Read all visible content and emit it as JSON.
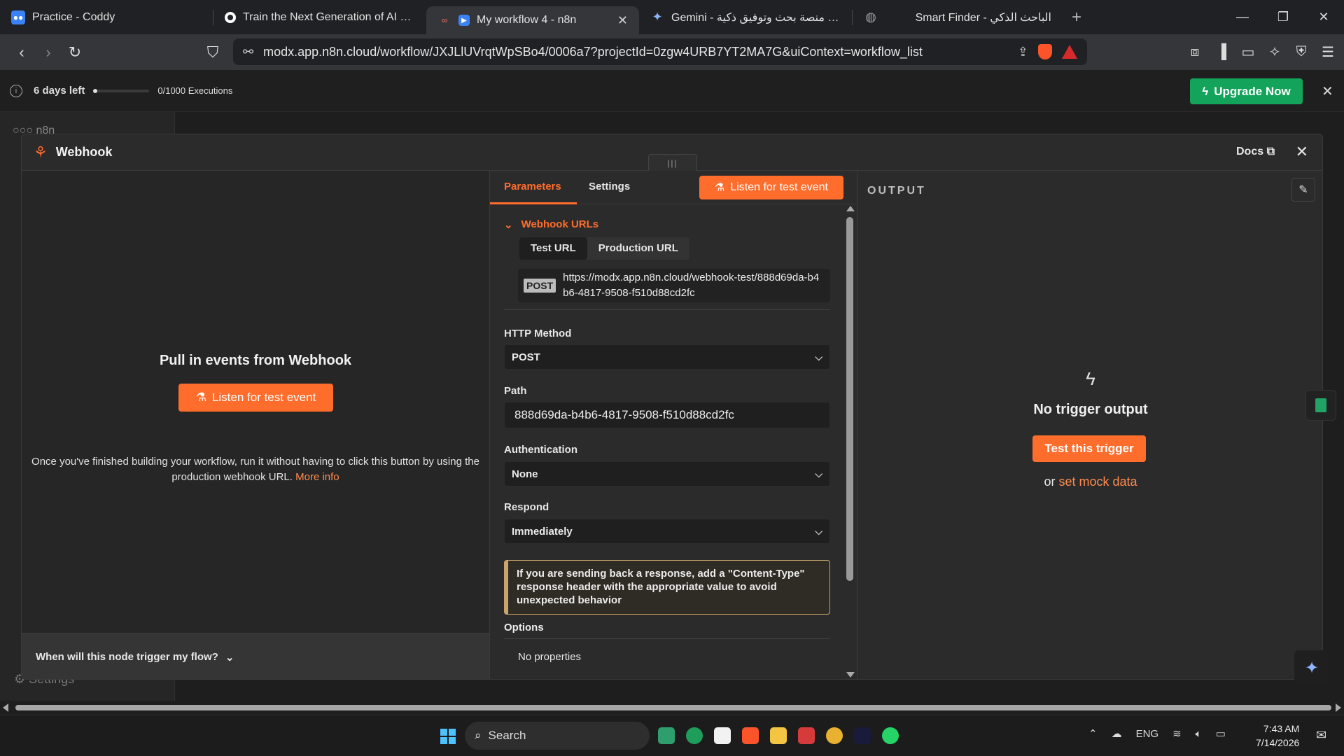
{
  "browser": {
    "tabs": [
      {
        "title": "Practice - Coddy",
        "icon_color": "#3b82f6",
        "active": false
      },
      {
        "title": "Train the Next Generation of AI as a F",
        "icon_color": "#ffffff",
        "active": false
      },
      {
        "title": "My workflow 4 - n8n",
        "icon_color": "#ff6d5a",
        "active": true
      },
      {
        "title": "Gemini - بناء منصة بحث وتوفيق ذكية",
        "icon_color": "#8ab4f8",
        "active": false
      },
      {
        "title": "Smart Finder - الباحث الذكي",
        "icon_color": "#9aa0a6",
        "active": false
      }
    ],
    "url": "modx.app.n8n.cloud/workflow/JXJLlUVrqtWpSBo4/0006a7?projectId=0zgw4URB7YT2MA7G&uiContext=workflow_list"
  },
  "trial": {
    "days_left": "6 days left",
    "executions": "0/1000 Executions",
    "upgrade_label": "Upgrade Now",
    "upgrade_color": "#13a35a"
  },
  "background": {
    "logo_text": "n8n",
    "settings_label": "Settings"
  },
  "modal": {
    "title": "Webhook",
    "docs_label": "Docs",
    "left": {
      "heading": "Pull in events from Webhook",
      "listen_label": "Listen for test event",
      "description": "Once you've finished building your workflow, run it without having to click this button by using the production webhook URL.",
      "more_info": "More info",
      "when_label": "When will this node trigger my flow?"
    },
    "params": {
      "tab_parameters": "Parameters",
      "tab_settings": "Settings",
      "listen_label": "Listen for test event",
      "webhook_urls_label": "Webhook URLs",
      "url_tabs": [
        "Test URL",
        "Production URL"
      ],
      "method_badge": "POST",
      "webhook_url": "https://modx.app.n8n.cloud/webhook-test/888d69da-b4b6-4817-9508-f510d88cd2fc",
      "http_method_label": "HTTP Method",
      "http_method_value": "POST",
      "path_label": "Path",
      "path_value": "888d69da-b4b6-4817-9508-f510d88cd2fc",
      "auth_label": "Authentication",
      "auth_value": "None",
      "respond_label": "Respond",
      "respond_value": "Immediately",
      "notice": "If you are sending back a response, add a \"Content-Type\" response header with the appropriate value to avoid unexpected behavior",
      "options_label": "Options",
      "no_properties": "No properties"
    },
    "output": {
      "label": "OUTPUT",
      "no_trigger": "No trigger output",
      "test_trigger_label": "Test this trigger",
      "or_text": "or",
      "mock_link": "set mock data"
    }
  },
  "taskbar": {
    "search_label": "Search",
    "lang": "ENG",
    "time": "7:43 AM",
    "date": "7/14/2026"
  },
  "colors": {
    "accent": "#ff6d2d"
  }
}
